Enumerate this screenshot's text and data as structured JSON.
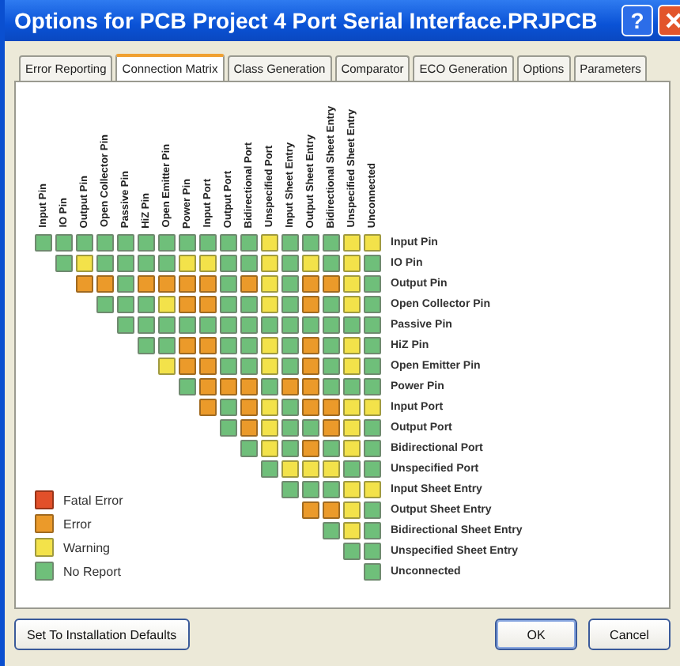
{
  "window": {
    "title": "Options for PCB Project 4 Port Serial Interface.PRJPCB",
    "help_button": "?"
  },
  "tabs": [
    {
      "label": "Error Reporting",
      "selected": false
    },
    {
      "label": "Connection Matrix",
      "selected": true
    },
    {
      "label": "Class Generation",
      "selected": false
    },
    {
      "label": "Comparator",
      "selected": false
    },
    {
      "label": "ECO Generation",
      "selected": false
    },
    {
      "label": "Options",
      "selected": false
    },
    {
      "label": "Parameters",
      "selected": false
    }
  ],
  "matrix": {
    "columns": [
      "Input Pin",
      "IO Pin",
      "Output Pin",
      "Open Collector Pin",
      "Passive Pin",
      "HiZ Pin",
      "Open Emitter Pin",
      "Power Pin",
      "Input Port",
      "Output Port",
      "Bidirectional Port",
      "Unspecified Port",
      "Input Sheet Entry",
      "Output Sheet Entry",
      "Bidirectional Sheet Entry",
      "Unspecified Sheet Entry",
      "Unconnected"
    ],
    "rows": [
      {
        "label": "Input Pin",
        "cells": [
          {
            "kind": "no_report"
          },
          {
            "kind": "no_report"
          },
          {
            "kind": "no_report"
          },
          {
            "kind": "no_report"
          },
          {
            "kind": "no_report"
          },
          {
            "kind": "no_report"
          },
          {
            "kind": "no_report"
          },
          {
            "kind": "no_report"
          },
          {
            "kind": "no_report"
          },
          {
            "kind": "no_report"
          },
          {
            "kind": "no_report"
          },
          {
            "kind": "warning"
          },
          {
            "kind": "no_report"
          },
          {
            "kind": "no_report"
          },
          {
            "kind": "no_report"
          },
          {
            "kind": "warning"
          },
          {
            "kind": "warning"
          }
        ]
      },
      {
        "label": "IO Pin",
        "cells": [
          {
            "kind": "no_report"
          },
          {
            "kind": "warning"
          },
          {
            "kind": "no_report"
          },
          {
            "kind": "no_report"
          },
          {
            "kind": "no_report"
          },
          {
            "kind": "no_report"
          },
          {
            "kind": "warning"
          },
          {
            "kind": "warning"
          },
          {
            "kind": "no_report"
          },
          {
            "kind": "no_report"
          },
          {
            "kind": "warning"
          },
          {
            "kind": "no_report"
          },
          {
            "kind": "warning"
          },
          {
            "kind": "no_report"
          },
          {
            "kind": "warning"
          },
          {
            "kind": "no_report"
          }
        ]
      },
      {
        "label": "Output Pin",
        "cells": [
          {
            "kind": "error"
          },
          {
            "kind": "error"
          },
          {
            "kind": "no_report"
          },
          {
            "kind": "error"
          },
          {
            "kind": "error"
          },
          {
            "kind": "error"
          },
          {
            "kind": "error"
          },
          {
            "kind": "no_report"
          },
          {
            "kind": "error"
          },
          {
            "kind": "warning"
          },
          {
            "kind": "no_report"
          },
          {
            "kind": "error"
          },
          {
            "kind": "error"
          },
          {
            "kind": "warning"
          },
          {
            "kind": "no_report"
          }
        ]
      },
      {
        "label": "Open Collector Pin",
        "cells": [
          {
            "kind": "no_report"
          },
          {
            "kind": "no_report"
          },
          {
            "kind": "no_report"
          },
          {
            "kind": "warning"
          },
          {
            "kind": "error"
          },
          {
            "kind": "error"
          },
          {
            "kind": "no_report"
          },
          {
            "kind": "no_report"
          },
          {
            "kind": "warning"
          },
          {
            "kind": "no_report"
          },
          {
            "kind": "error"
          },
          {
            "kind": "no_report"
          },
          {
            "kind": "warning"
          },
          {
            "kind": "no_report"
          }
        ]
      },
      {
        "label": "Passive Pin",
        "cells": [
          {
            "kind": "no_report"
          },
          {
            "kind": "no_report"
          },
          {
            "kind": "no_report"
          },
          {
            "kind": "no_report"
          },
          {
            "kind": "no_report"
          },
          {
            "kind": "no_report"
          },
          {
            "kind": "no_report"
          },
          {
            "kind": "no_report"
          },
          {
            "kind": "no_report"
          },
          {
            "kind": "no_report"
          },
          {
            "kind": "no_report"
          },
          {
            "kind": "no_report"
          },
          {
            "kind": "no_report"
          }
        ]
      },
      {
        "label": "HiZ Pin",
        "cells": [
          {
            "kind": "no_report"
          },
          {
            "kind": "no_report"
          },
          {
            "kind": "error"
          },
          {
            "kind": "error"
          },
          {
            "kind": "no_report"
          },
          {
            "kind": "no_report"
          },
          {
            "kind": "warning"
          },
          {
            "kind": "no_report"
          },
          {
            "kind": "error"
          },
          {
            "kind": "no_report"
          },
          {
            "kind": "warning"
          },
          {
            "kind": "no_report"
          }
        ]
      },
      {
        "label": "Open Emitter Pin",
        "cells": [
          {
            "kind": "warning"
          },
          {
            "kind": "error"
          },
          {
            "kind": "error"
          },
          {
            "kind": "no_report"
          },
          {
            "kind": "no_report"
          },
          {
            "kind": "warning"
          },
          {
            "kind": "no_report"
          },
          {
            "kind": "error"
          },
          {
            "kind": "no_report"
          },
          {
            "kind": "warning"
          },
          {
            "kind": "no_report"
          }
        ]
      },
      {
        "label": "Power Pin",
        "cells": [
          {
            "kind": "no_report"
          },
          {
            "kind": "error"
          },
          {
            "kind": "error"
          },
          {
            "kind": "error"
          },
          {
            "kind": "no_report"
          },
          {
            "kind": "error"
          },
          {
            "kind": "error"
          },
          {
            "kind": "no_report"
          },
          {
            "kind": "no_report"
          },
          {
            "kind": "no_report"
          }
        ]
      },
      {
        "label": "Input Port",
        "cells": [
          {
            "kind": "error"
          },
          {
            "kind": "no_report"
          },
          {
            "kind": "error"
          },
          {
            "kind": "warning"
          },
          {
            "kind": "no_report"
          },
          {
            "kind": "error"
          },
          {
            "kind": "error"
          },
          {
            "kind": "warning"
          },
          {
            "kind": "warning"
          }
        ]
      },
      {
        "label": "Output Port",
        "cells": [
          {
            "kind": "no_report"
          },
          {
            "kind": "error"
          },
          {
            "kind": "warning"
          },
          {
            "kind": "no_report"
          },
          {
            "kind": "no_report"
          },
          {
            "kind": "error"
          },
          {
            "kind": "warning"
          },
          {
            "kind": "no_report"
          }
        ]
      },
      {
        "label": "Bidirectional Port",
        "cells": [
          {
            "kind": "no_report"
          },
          {
            "kind": "warning"
          },
          {
            "kind": "no_report"
          },
          {
            "kind": "error"
          },
          {
            "kind": "no_report"
          },
          {
            "kind": "warning"
          },
          {
            "kind": "no_report"
          }
        ]
      },
      {
        "label": "Unspecified Port",
        "cells": [
          {
            "kind": "no_report"
          },
          {
            "kind": "warning"
          },
          {
            "kind": "warning"
          },
          {
            "kind": "warning"
          },
          {
            "kind": "no_report"
          },
          {
            "kind": "no_report"
          }
        ]
      },
      {
        "label": "Input Sheet Entry",
        "cells": [
          {
            "kind": "no_report"
          },
          {
            "kind": "no_report"
          },
          {
            "kind": "no_report"
          },
          {
            "kind": "warning"
          },
          {
            "kind": "warning"
          }
        ]
      },
      {
        "label": "Output Sheet Entry",
        "cells": [
          {
            "kind": "error"
          },
          {
            "kind": "error"
          },
          {
            "kind": "warning"
          },
          {
            "kind": "no_report"
          }
        ]
      },
      {
        "label": "Bidirectional Sheet Entry",
        "cells": [
          {
            "kind": "no_report"
          },
          {
            "kind": "warning"
          },
          {
            "kind": "no_report"
          }
        ]
      },
      {
        "label": "Unspecified Sheet Entry",
        "cells": [
          {
            "kind": "no_report"
          },
          {
            "kind": "no_report"
          }
        ]
      },
      {
        "label": "Unconnected",
        "cells": [
          {
            "kind": "no_report"
          }
        ]
      }
    ]
  },
  "legend": [
    {
      "label": "Fatal Error",
      "kind": "fatal_error"
    },
    {
      "label": "Error",
      "kind": "error"
    },
    {
      "label": "Warning",
      "kind": "warning"
    },
    {
      "label": "No Report",
      "kind": "no_report"
    }
  ],
  "buttons": {
    "defaults": "Set To Installation Defaults",
    "ok": "OK",
    "cancel": "Cancel"
  }
}
